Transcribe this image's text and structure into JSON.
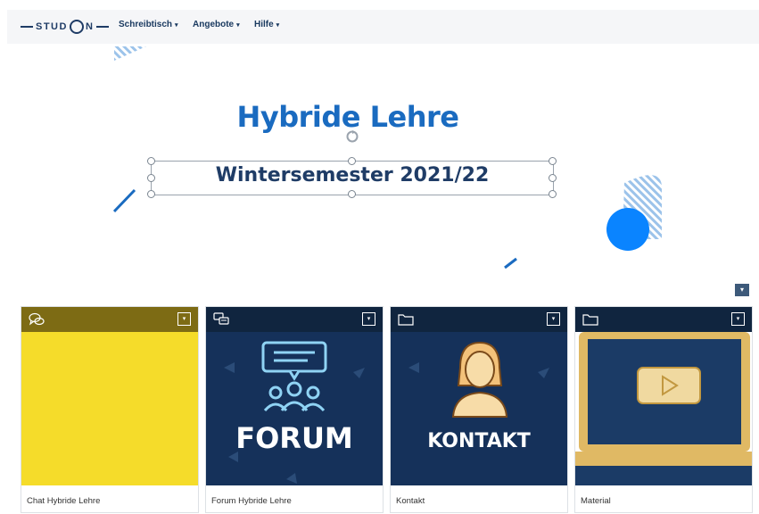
{
  "header": {
    "logo_text": "STUD",
    "logo_text_end": "N",
    "menus": [
      {
        "label": "Schreibtisch",
        "caret": "▾"
      },
      {
        "label": "Angebote",
        "caret": "▾"
      },
      {
        "label": "Hilfe",
        "caret": "▾"
      }
    ]
  },
  "banner": {
    "title": "Hybride Lehre",
    "subtitle": "Wintersemester 2021/22"
  },
  "page_action_caret": "▾",
  "tiles": [
    {
      "caption": "Chat Hybride Lehre",
      "type_icon": "chat-icon",
      "menu_caret": "▾",
      "header_color": "#7d6b14",
      "image_color": "#f5dc2a"
    },
    {
      "caption": "Forum Hybride Lehre",
      "type_icon": "forum-icon",
      "menu_caret": "▾",
      "header_color": "#10253f",
      "image_color": "#15315a",
      "image_text": "FORUM"
    },
    {
      "caption": "Kontakt",
      "type_icon": "folder-icon",
      "menu_caret": "▾",
      "header_color": "#10253f",
      "image_color": "#15315a",
      "image_text": "KONTAKT"
    },
    {
      "caption": "Material",
      "type_icon": "folder-icon",
      "menu_caret": "▾",
      "header_color": "#10253f",
      "image_color": "#1b3b66"
    }
  ],
  "colors": {
    "brand_navy": "#1f3c66",
    "title_blue": "#1a6bc0",
    "accent_blue": "#0a84ff",
    "gold": "#e0b964"
  }
}
